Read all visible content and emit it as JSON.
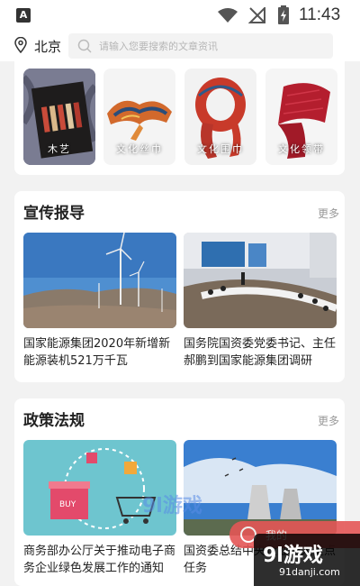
{
  "status_bar": {
    "time": "11:43",
    "notification_icon": "a-letter-icon",
    "wifi_icon": "wifi-icon",
    "signal_icon": "no-signal-icon",
    "battery_icon": "battery-charging-icon"
  },
  "header": {
    "location": "北京",
    "search_placeholder": "请输入您要搜索的文章资讯"
  },
  "culture": {
    "items": [
      {
        "label": "木艺"
      },
      {
        "label": "文化丝巾"
      },
      {
        "label": "文化围巾"
      },
      {
        "label": "文化领带"
      }
    ]
  },
  "promo": {
    "title": "宣传报导",
    "more": "更多",
    "news": [
      {
        "title": "国家能源集团2020年新增新能源装机521万千瓦"
      },
      {
        "title": "国务院国资委党委书记、主任郝鹏到国家能源集团调研"
      }
    ]
  },
  "policy": {
    "title": "政策法规",
    "more": "更多",
    "news": [
      {
        "title": "商务部办公厅关于推动电子商务企业绿色发展工作的通知"
      },
      {
        "title": "国资委总结中央企业十大重点任务"
      }
    ]
  },
  "floating": {
    "label": "我的"
  },
  "watermark": {
    "main": "9l游戏",
    "sub": "91danji.com",
    "center": "9l游戏"
  },
  "colors": {
    "accent": "#e45656",
    "background": "#f2f2f2"
  }
}
